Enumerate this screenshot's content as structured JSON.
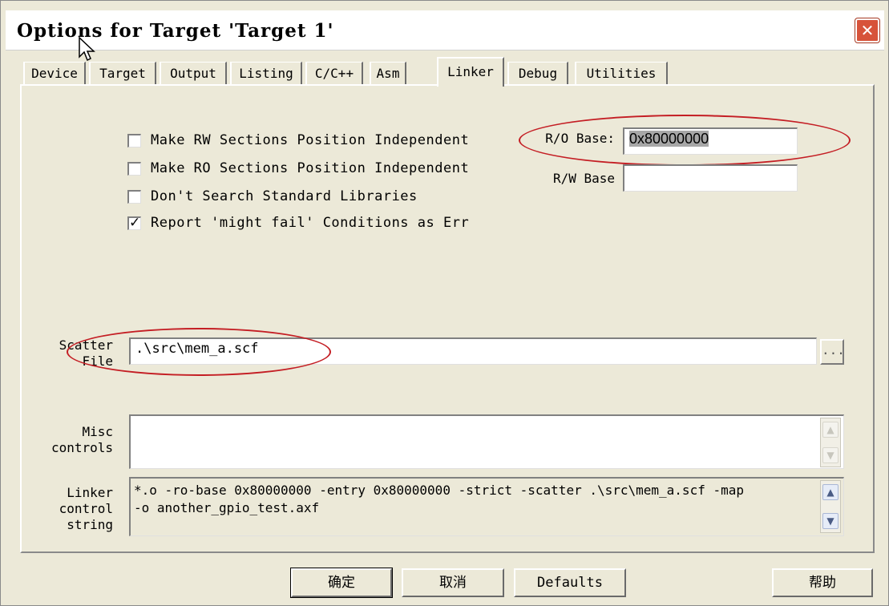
{
  "window": {
    "title": "Options for Target 'Target 1'",
    "close_glyph": "✕"
  },
  "tabs": [
    "Device",
    "Target",
    "Output",
    "Listing",
    "C/C++",
    "Asm",
    "Linker",
    "Debug",
    "Utilities"
  ],
  "active_tab": "Linker",
  "checkboxes": [
    {
      "label": "Make RW Sections Position Independent",
      "checked": false
    },
    {
      "label": "Make RO Sections Position Independent",
      "checked": false
    },
    {
      "label": "Don't Search Standard Libraries",
      "checked": false
    },
    {
      "label": "Report 'might fail' Conditions as Err",
      "checked": true
    }
  ],
  "check_glyph": "✓",
  "ro_base": {
    "label": "R/O Base:",
    "value": "0x80000000"
  },
  "rw_base": {
    "label": "R/W Base",
    "value": ""
  },
  "scatter": {
    "label_line1": "Scatter",
    "label_line2": "File",
    "value": ".\\src\\mem_a.scf",
    "browse_label": "..."
  },
  "misc": {
    "label_line1": "Misc",
    "label_line2": "controls",
    "value": ""
  },
  "linker_control": {
    "label_line1": "Linker",
    "label_line2": "control",
    "label_line3": "string",
    "line1": "*.o -ro-base 0x80000000 -entry 0x80000000 -strict -scatter .\\src\\mem_a.scf -map",
    "line2": "-o another_gpio_test.axf"
  },
  "scroll_glyphs": {
    "up": "▲",
    "down": "▼"
  },
  "buttons": {
    "ok": "确定",
    "cancel": "取消",
    "defaults": "Defaults",
    "help": "帮助"
  },
  "colors": {
    "annotation_red": "#c41e24",
    "dialog_bg": "#ece9d8",
    "close_red": "#d7533a"
  }
}
